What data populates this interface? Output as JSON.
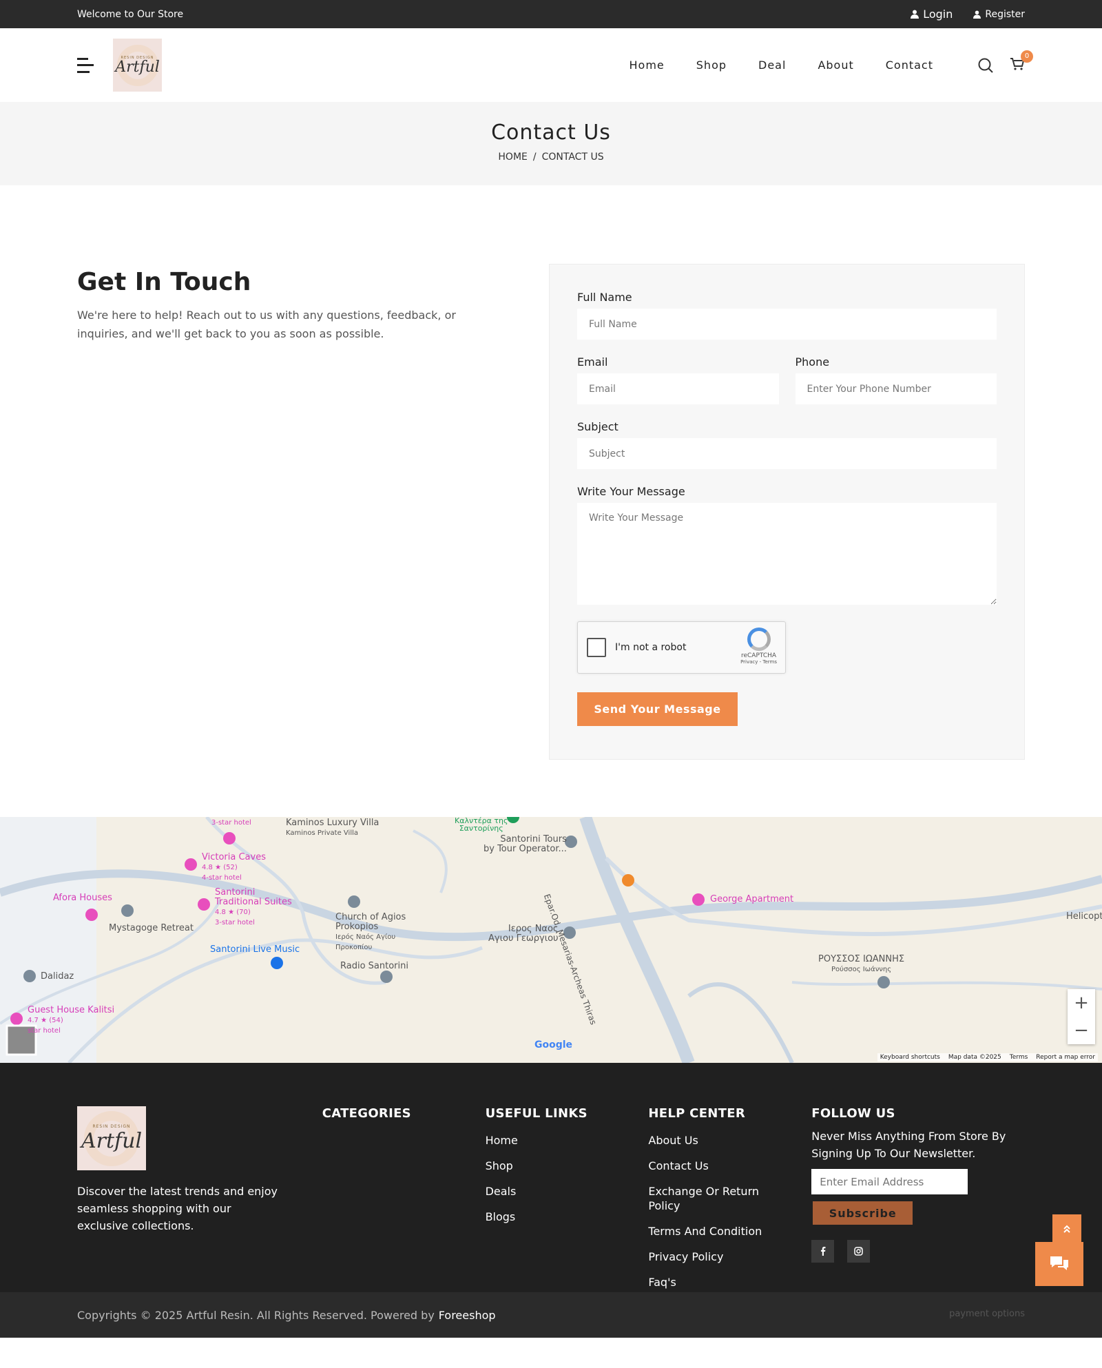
{
  "topbar": {
    "welcome": "Welcome to Our Store",
    "login": "Login",
    "register": "Register"
  },
  "header": {
    "logo_small": "RESIN DESIGN",
    "logo_big": "Artful",
    "nav": [
      "Home",
      "Shop",
      "Deal",
      "About",
      "Contact"
    ],
    "cart_count": "0"
  },
  "banner": {
    "title": "Contact Us",
    "crumb_home": "HOME",
    "sep": "/",
    "crumb_current": "CONTACT US"
  },
  "intro": {
    "heading": "Get In Touch",
    "text": "We're here to help! Reach out to us with any questions, feedback, or inquiries, and we'll get back to you as soon as possible."
  },
  "form": {
    "fullname_label": "Full Name",
    "fullname_placeholder": "Full Name",
    "email_label": "Email",
    "email_placeholder": "Email",
    "phone_label": "Phone",
    "phone_placeholder": "Enter Your Phone Number",
    "subject_label": "Subject",
    "subject_placeholder": "Subject",
    "message_label": "Write Your Message",
    "message_placeholder": "Write Your Message",
    "captcha_text": "I'm not a robot",
    "captcha_brand": "reCAPTCHA",
    "captcha_links": "Privacy - Terms",
    "submit": "Send Your Message"
  },
  "map": {
    "labels": {
      "l1": "3-star hotel",
      "l2": "Kaminos Luxury Villa",
      "l2s": "Kaminos Private Villa",
      "l3": "Καλντέρα της",
      "l3s": "Σαντορίνης",
      "l4": "Santorini Tours",
      "l4s": "by Tour Operator...",
      "l5": "Victoria Caves",
      "l5s": "4.8 ★ (52)",
      "l5t": "4-star hotel",
      "l6": "Santorini",
      "l6b": "Traditional Suites",
      "l6s": "4.8 ★ (70)",
      "l6t": "3-star hotel",
      "l7": "Afora Houses",
      "l8": "Mystagoge Retreat",
      "l9": "Church of Agios",
      "l9b": "Prokopios",
      "l9s": "Ιερός Ναός Αγίου",
      "l9t": "Προκοπίου",
      "l10": "Ιερος Ναος",
      "l10b": "Αγιου Γεωργιου",
      "l11": "George Apartment",
      "l12": "Helicopt",
      "l13": "Santorini Live Music",
      "l14": "Radio Santorini",
      "l15": "ΡΟΥΣΣΟΣ ΙΩΑΝΝΗΣ",
      "l15s": "Ρούσσος Ιωάννης",
      "l16": "Dalidaz",
      "l17": "Guest House Kalitsi",
      "l17s": "4.7 ★ (54)",
      "l17t": "star hotel",
      "road": "Epar.Od. Mesarias-Archeas Thiras",
      "google": "Google"
    },
    "zoom_in": "+",
    "zoom_out": "−",
    "footer": [
      "Keyboard shortcuts",
      "Map data ©2025",
      "Terms",
      "Report a map error"
    ]
  },
  "footer": {
    "about": "Discover the latest trends and enjoy seamless shopping with our exclusive collections.",
    "categories_title": "CATEGORIES",
    "useful_title": "USEFUL LINKS",
    "useful": [
      "Home",
      "Shop",
      "Deals",
      "Blogs"
    ],
    "help_title": "HELP CENTER",
    "help": [
      "About Us",
      "Contact Us",
      "Exchange Or Return Policy",
      "Terms And Condition",
      "Privacy Policy",
      "Faq's"
    ],
    "follow_title": "FOLLOW US",
    "follow_text": "Never Miss Anything From Store By Signing Up To Our Newsletter.",
    "email_placeholder": "Enter Email Address",
    "subscribe": "Subscribe",
    "copyright": "Copyrights © 2025 Artful Resin. All Rights Reserved. Powered by",
    "powered": "Foreeshop",
    "payment_alt": "payment options"
  },
  "colors": {
    "accent": "#ef8a4a",
    "dark": "#202020",
    "subscribe": "#a85e36"
  }
}
